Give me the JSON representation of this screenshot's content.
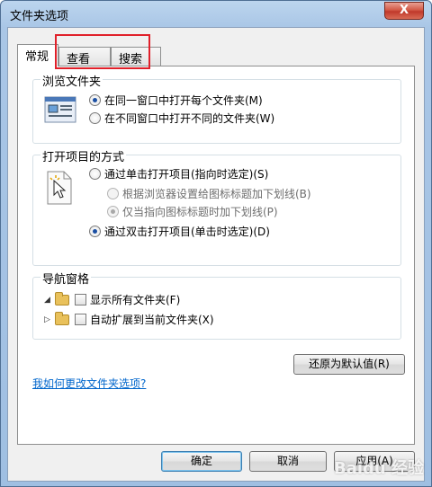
{
  "window": {
    "title": "文件夹选项",
    "close_label": "X"
  },
  "tabs": [
    {
      "label": "常规",
      "active": true
    },
    {
      "label": "查看",
      "active": false
    },
    {
      "label": "搜索",
      "active": false
    }
  ],
  "browse_group": {
    "legend": "浏览文件夹",
    "options": [
      {
        "label": "在同一窗口中打开每个文件夹(M)",
        "selected": true
      },
      {
        "label": "在不同窗口中打开不同的文件夹(W)",
        "selected": false
      }
    ]
  },
  "click_group": {
    "legend": "打开项目的方式",
    "single_click": {
      "label": "通过单击打开项目(指向时选定)(S)",
      "selected": false
    },
    "sub_options": [
      {
        "label": "根据浏览器设置给图标标题加下划线(B)",
        "selected": false
      },
      {
        "label": "仅当指向图标标题时加下划线(P)",
        "selected": true
      }
    ],
    "double_click": {
      "label": "通过双击打开项目(单击时选定)(D)",
      "selected": true
    }
  },
  "nav_group": {
    "legend": "导航窗格",
    "items": [
      {
        "label": "显示所有文件夹(F)",
        "checked": false
      },
      {
        "label": "自动扩展到当前文件夹(X)",
        "checked": false
      }
    ]
  },
  "restore_button": "还原为默认值(R)",
  "help_link": "我如何更改文件夹选项?",
  "footer": {
    "ok": "确定",
    "cancel": "取消",
    "apply": "应用(A)"
  },
  "watermark": "Baidu 经验"
}
